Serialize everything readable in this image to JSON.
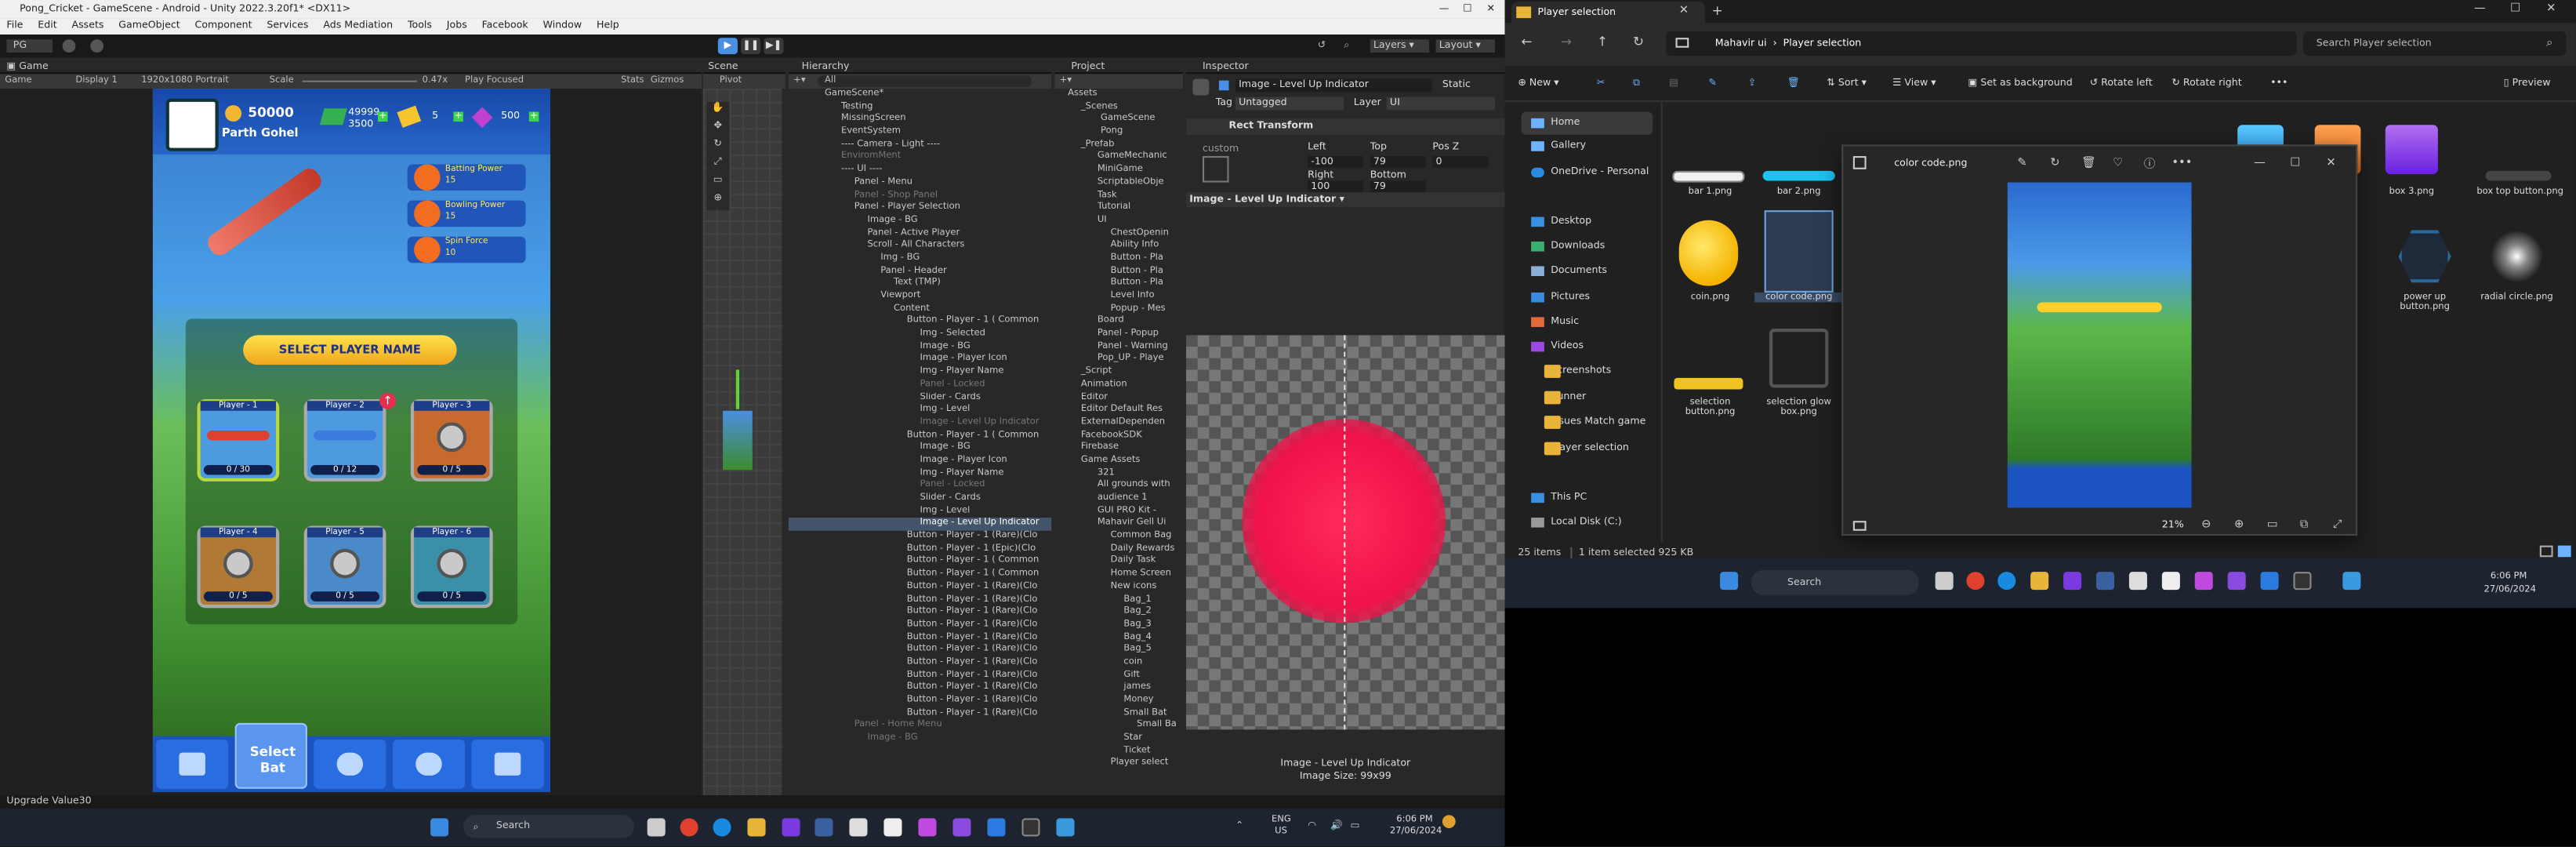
{
  "unity": {
    "title": "Pong_Cricket - GameScene - Android - Unity 2022.3.20f1* <DX11>",
    "menu": [
      "File",
      "Edit",
      "Assets",
      "GameObject",
      "Component",
      "Services",
      "Ads Mediation",
      "Tools",
      "Jobs",
      "Facebook",
      "Window",
      "Help"
    ],
    "toolbar": {
      "pg": "PG",
      "layers": "Layers",
      "layout": "Layout"
    },
    "game_tab": "Game",
    "game_mode": "Game",
    "display": "Display 1",
    "resolution": "1920x1080 Portrait",
    "scale_label": "Scale",
    "scale_value": "0.47x",
    "play_focused": "Play Focused",
    "stats": "Stats",
    "gizmos": "Gizmos",
    "scene_tab": "Scene",
    "pivot": "Pivot",
    "hierarchy_tab": "Hierarchy",
    "hierarchy_search": "All",
    "hierarchy": [
      "GameScene*",
      "Testing",
      "MissingScreen",
      "EventSystem",
      "---- Camera - Light ----",
      "EnviromMent",
      "---- UI ----",
      "Panel - Menu",
      "Panel - Shop Panel",
      "Panel - Player Selection",
      "Image - BG",
      "Panel - Active Player",
      "Scroll - All Characters",
      "Img - BG",
      "Panel - Header",
      "Text (TMP)",
      "Viewport",
      "Content",
      "Button - Player - 1 ( Common",
      "Img - Selected",
      "Image - BG",
      "Image - Player Icon",
      "Img - Player Name",
      "Panel - Locked",
      "Slider - Cards",
      "Img - Level",
      "Image - Level Up Indicator",
      "Button - Player - 1 ( Common",
      "Image - BG",
      "Image - Player Icon",
      "Img - Player Name",
      "Panel - Locked",
      "Slider - Cards",
      "Img - Level",
      "Image - Level Up Indicator",
      "Button - Player - 1 (Rare)(Clo",
      "Button - Player - 1 (Epic)(Clo",
      "Button - Player - 1 ( Common",
      "Button - Player - 1 ( Common",
      "Button - Player - 1 (Rare)(Clo",
      "Button - Player - 1 (Rare)(Clo",
      "Button - Player - 1 (Rare)(Clo",
      "Button - Player - 1 (Rare)(Clo",
      "Button - Player - 1 (Rare)(Clo",
      "Button - Player - 1 (Rare)(Clo",
      "Button - Player - 1 (Rare)(Clo",
      "Button - Player - 1 (Rare)(Clo",
      "Button - Player - 1 (Rare)(Clo",
      "Button - Player - 1 (Rare)(Clo",
      "Button - Player - 1 (Rare)(Clo",
      "Panel - Home Menu",
      "Image - BG"
    ],
    "project_tab": "Project",
    "project": [
      "Assets",
      "_Scenes",
      "GameScene",
      "Pong",
      "_Prefab",
      "GameMechanic",
      "MiniGame",
      "ScriptableObje",
      "Task",
      "Tutorial",
      "UI",
      "ChestOpenin",
      "Ability Info",
      "Button - Pla",
      "Button - Pla",
      "Button - Pla",
      "Level Info",
      "Popup - Mes",
      "Board",
      "Panel - Popup",
      "Panel - Warning",
      "Pop_UP - Playe",
      "_Script",
      "Animation",
      "Editor",
      "Editor Default Res",
      "ExternalDependen",
      "FacebookSDK",
      "Firebase",
      "Game Assets",
      "321",
      "All grounds with",
      "audience 1",
      "GUI PRO Kit -",
      "Mahavir Gell Ui",
      "Common Bag",
      "Daily Rewards",
      "Daily Task",
      "Home Screen",
      "New icons",
      "Bag_1",
      "Bag_2",
      "Bag_3",
      "Bag_4",
      "Bag_5",
      "coin",
      "Gift",
      "james",
      "Money",
      "Small Bat",
      "Small Ba",
      "Star",
      "Ticket",
      "Player select"
    ],
    "inspector_tab": "Inspector",
    "inspector": {
      "object": "Image - Level Up Indicator",
      "static": "Static",
      "tag_label": "Tag",
      "tag": "Untagged",
      "layer_label": "Layer",
      "layer": "UI",
      "rect": "Rect Transform",
      "custom": "custom",
      "left_label": "Left",
      "top_label": "Top",
      "posz_label": "Pos Z",
      "left": "-100",
      "top": "79",
      "posz": "0",
      "right_label": "Right",
      "bottom_label": "Bottom",
      "right": "100",
      "bottom": "79",
      "component": "Image - Level Up Indicator",
      "preview_name": "Image - Level Up Indicator",
      "preview_size": "Image Size: 99x99"
    },
    "status": "Upgrade Value30",
    "game": {
      "player_name": "Parth Gohel",
      "coins": "50000",
      "gems": "49999",
      "gems_sub": "3500",
      "tickets": "5",
      "gold": "500",
      "title": "SELECT PLAYER NAME",
      "batting_label": "Batting Power",
      "batting": "15",
      "bowling_label": "Bowling Power",
      "bowling": "15",
      "spin_label": "Spin Force",
      "spin": "10",
      "select_bat": "Select Bat",
      "cards": [
        {
          "name": "Player - 1",
          "count": "0 / 30"
        },
        {
          "name": "Player - 2",
          "count": "0 / 12"
        },
        {
          "name": "Player - 3",
          "count": "0 / 5"
        },
        {
          "name": "Player - 4",
          "count": "0 / 5"
        },
        {
          "name": "Player - 5",
          "count": "0 / 5"
        },
        {
          "name": "Player - 6",
          "count": "0 / 5"
        }
      ]
    }
  },
  "explorer": {
    "window_title": "Player selection",
    "breadcrumb": [
      "Mahavir ui",
      "Player selection"
    ],
    "search_placeholder": "Search Player selection",
    "commands": [
      "New",
      "Sort",
      "View",
      "Set as background",
      "Rotate left",
      "Rotate right",
      "Preview"
    ],
    "sidebar": [
      "Home",
      "Gallery",
      "OneDrive - Personal",
      "Desktop",
      "Downloads",
      "Documents",
      "Pictures",
      "Music",
      "Videos",
      "Screenshots",
      "Runner",
      "Issues Match game",
      "Player selection",
      "This PC",
      "Local Disk (C:)"
    ],
    "files": [
      "bar 1.png",
      "bar 2.png",
      "coin.png",
      "color code.png",
      "selection button.png",
      "selection glow box.png",
      "box 3.png",
      "box top button.png",
      "power up button.png",
      "radial circle.png",
      "ng"
    ],
    "status_items": "25 items",
    "status_selected": "1 item selected  925 KB",
    "viewer": {
      "title": "color code.png",
      "zoom": "21%"
    }
  },
  "taskbar": {
    "search": "Search",
    "lang": "ENG",
    "region": "US",
    "time": "6:06 PM",
    "date": "27/06/2024"
  }
}
